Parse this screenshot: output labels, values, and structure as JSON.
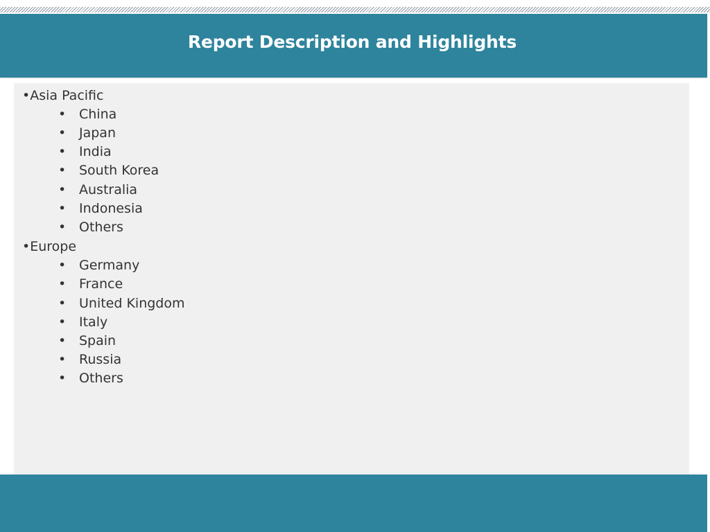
{
  "header": {
    "title": "Report Description and Highlights"
  },
  "regions": [
    {
      "label": "Asia Pacific",
      "items": [
        "China",
        "Japan",
        "India",
        "South Korea",
        "Australia",
        "Indonesia",
        "Others"
      ]
    },
    {
      "label": "Europe",
      "items": [
        "Germany",
        "France",
        "United Kingdom",
        "Italy",
        "Spain",
        "Russia",
        "Others"
      ]
    }
  ],
  "bullet_char": "•",
  "colors": {
    "header_band": "#2e849c",
    "panel_bg": "#f0f0f0",
    "text": "#333333"
  }
}
